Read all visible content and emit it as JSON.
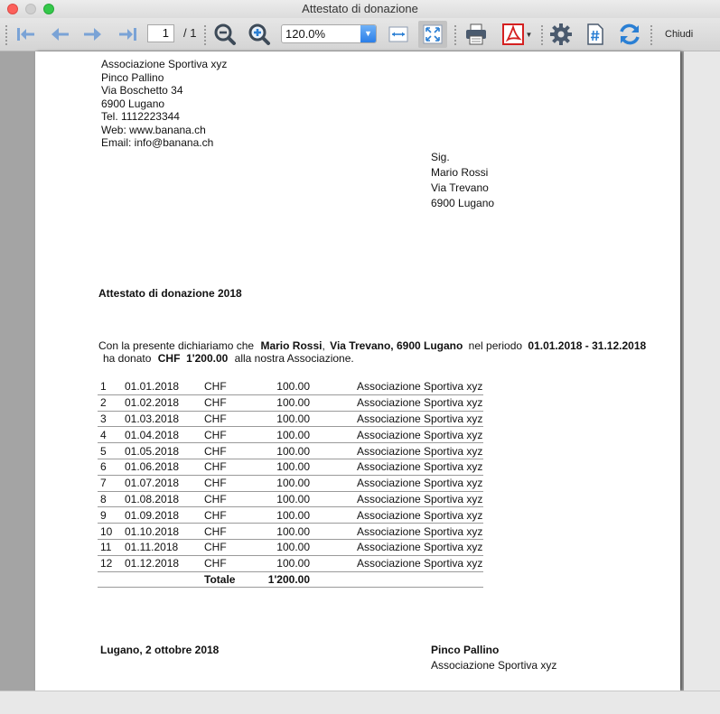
{
  "window": {
    "title": "Attestato di donazione"
  },
  "toolbar": {
    "page_current": "1",
    "page_total": "/ 1",
    "zoom": "120.0%",
    "close_label": "Chiudi"
  },
  "sender": [
    "Associazione Sportiva xyz",
    "Pinco Pallino",
    "Via Boschetto 34",
    "6900 Lugano",
    "Tel. 1112223344",
    "Web: www.banana.ch",
    "Email: info@banana.ch"
  ],
  "recipient": [
    "Sig.",
    "Mario Rossi",
    "Via Trevano",
    "6900 Lugano"
  ],
  "doc": {
    "title": "Attestato di donazione 2018",
    "body1_a": "Con la presente dichiariamo che",
    "body1_name": "Mario Rossi",
    "body1_comma": ",",
    "body1_addr": "Via Trevano, 6900 Lugano",
    "body1_period_label": "nel periodo",
    "body1_period": "01.01.2018 - 31.12.2018",
    "body2_a": "ha donato",
    "body2_amount": "CHF  1'200.00",
    "body2_b": "alla nostra Associazione."
  },
  "donations": {
    "rows": [
      [
        "1",
        "01.01.2018",
        "CHF",
        "100.00",
        "Associazione Sportiva xyz"
      ],
      [
        "2",
        "01.02.2018",
        "CHF",
        "100.00",
        "Associazione Sportiva xyz"
      ],
      [
        "3",
        "01.03.2018",
        "CHF",
        "100.00",
        "Associazione Sportiva xyz"
      ],
      [
        "4",
        "01.04.2018",
        "CHF",
        "100.00",
        "Associazione Sportiva xyz"
      ],
      [
        "5",
        "01.05.2018",
        "CHF",
        "100.00",
        "Associazione Sportiva xyz"
      ],
      [
        "6",
        "01.06.2018",
        "CHF",
        "100.00",
        "Associazione Sportiva xyz"
      ],
      [
        "7",
        "01.07.2018",
        "CHF",
        "100.00",
        "Associazione Sportiva xyz"
      ],
      [
        "8",
        "01.08.2018",
        "CHF",
        "100.00",
        "Associazione Sportiva xyz"
      ],
      [
        "9",
        "01.09.2018",
        "CHF",
        "100.00",
        "Associazione Sportiva xyz"
      ],
      [
        "10",
        "01.10.2018",
        "CHF",
        "100.00",
        "Associazione Sportiva xyz"
      ],
      [
        "11",
        "01.11.2018",
        "CHF",
        "100.00",
        "Associazione Sportiva xyz"
      ],
      [
        "12",
        "01.12.2018",
        "CHF",
        "100.00",
        "Associazione Sportiva xyz"
      ]
    ],
    "total_label": "Totale",
    "total_value": "1'200.00"
  },
  "footer": {
    "place_date": "Lugano, 2 ottobre 2018",
    "signer_name": "Pinco Pallino",
    "signer_org": "Associazione Sportiva xyz"
  },
  "colors": {
    "nav_arrow": "#7aa3d6",
    "zoom_icon": "#3d4a58",
    "pdf_red": "#d42020",
    "refresh_blue": "#2a7fd4"
  }
}
